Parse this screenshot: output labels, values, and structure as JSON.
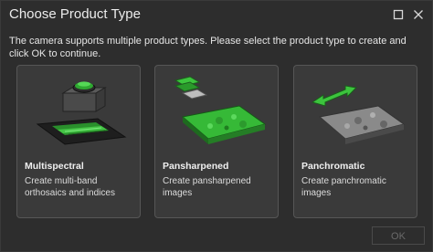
{
  "window": {
    "title": "Choose Product Type",
    "maximize_icon": "maximize-icon",
    "close_icon": "close-icon"
  },
  "description": "The camera supports multiple product types. Please select the product type to create and click OK to continue.",
  "cards": [
    {
      "name": "Multispectral",
      "description": "Create multi-band orthosaics and indices",
      "icon": "multispectral-icon"
    },
    {
      "name": "Pansharpened",
      "description": "Create pansharpened images",
      "icon": "pansharpened-icon"
    },
    {
      "name": "Panchromatic",
      "description": "Create panchromatic images",
      "icon": "panchromatic-icon"
    }
  ],
  "footer": {
    "ok_label": "OK",
    "ok_enabled": false
  },
  "colors": {
    "accent_green": "#39c13a",
    "background": "#2d2d2d",
    "card": "#3a3a3a"
  }
}
